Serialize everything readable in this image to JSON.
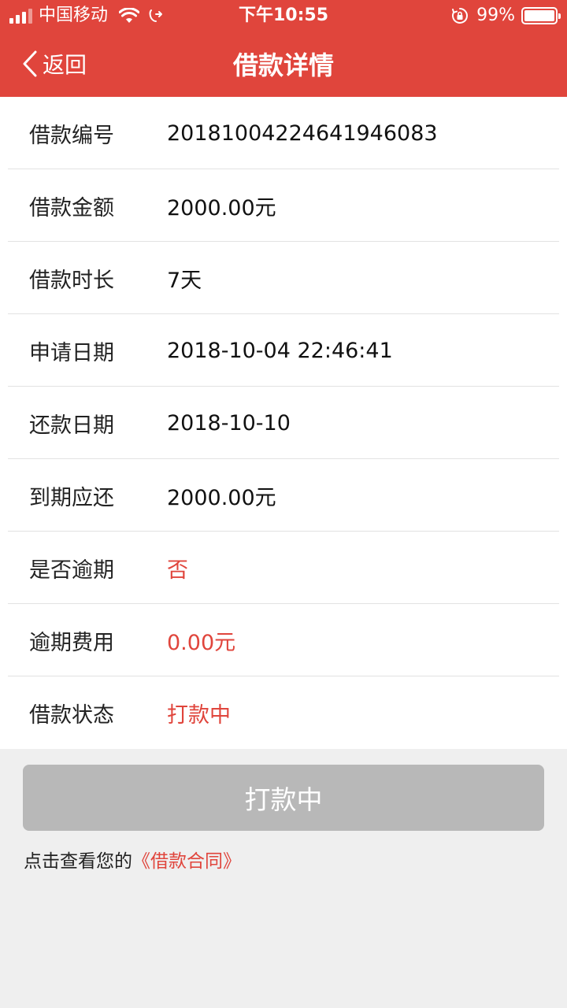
{
  "status_bar": {
    "carrier": "中国移动",
    "time": "下午10:55",
    "battery": "99%",
    "icons": [
      "signal-icon",
      "wifi-icon",
      "call-forward-icon",
      "rotation-lock-icon",
      "battery-icon"
    ]
  },
  "nav": {
    "back_label": "返回",
    "title": "借款详情"
  },
  "details": [
    {
      "label": "借款编号",
      "value": "20181004224641946083"
    },
    {
      "label": "借款金额",
      "value": "2000.00元"
    },
    {
      "label": "借款时长",
      "value": "7天"
    },
    {
      "label": "申请日期",
      "value": "2018-10-04 22:46:41"
    },
    {
      "label": "还款日期",
      "value": "2018-10-10"
    },
    {
      "label": "到期应还",
      "value": "2000.00元"
    },
    {
      "label": "是否逾期",
      "value": "否"
    },
    {
      "label": "逾期费用",
      "value": "0.00元"
    },
    {
      "label": "借款状态",
      "value": "打款中"
    }
  ],
  "action": {
    "button_label": "打款中"
  },
  "contract": {
    "prefix": "点击查看您的",
    "link": "《借款合同》"
  },
  "colors": {
    "brand_red": "#e0453c",
    "button_disabled": "#b8b8b8",
    "page_bg": "#efefef"
  }
}
